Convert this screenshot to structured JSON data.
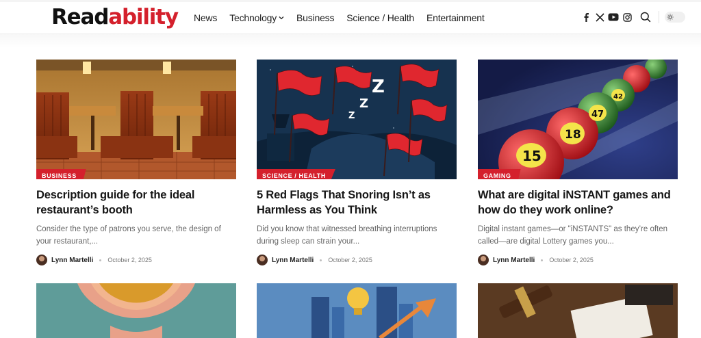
{
  "header": {
    "logo_part1": "Read",
    "logo_part2": "ability",
    "nav": [
      {
        "label": "News"
      },
      {
        "label": "Technology"
      },
      {
        "label": "Business"
      },
      {
        "label": "Science / Health"
      },
      {
        "label": "Entertainment"
      }
    ],
    "icons": [
      "facebook-icon",
      "x-twitter-icon",
      "youtube-icon",
      "instagram-icon",
      "search-icon"
    ],
    "theme_toggle": "sun-icon"
  },
  "posts": [
    {
      "category": "BUSINESS",
      "title": "Description guide for the ideal restaurant’s booth",
      "excerpt": "Consider the type of patrons you serve, the design of your restaurant,...",
      "author": "Lynn Martelli",
      "date": "October 2, 2025"
    },
    {
      "category": "SCIENCE / HEALTH",
      "title": "5 Red Flags That Snoring Isn’t as Harmless as You Think",
      "excerpt": "Did you know that witnessed breathing interruptions during sleep can strain your...",
      "author": "Lynn Martelli",
      "date": "October 2, 2025"
    },
    {
      "category": "GAMING",
      "title": "What are digital iNSTANT games and how do they work online?",
      "excerpt": "Digital instant games—or \"iNSTANTS\" as they’re often called—are digital Lottery games you...",
      "author": "Lynn Martelli",
      "date": "October 2, 2025"
    }
  ],
  "lottery_ball_numbers": [
    "15",
    "18",
    "47",
    "42"
  ],
  "colors": {
    "accent": "#d4202c",
    "text": "#161616",
    "muted": "#666666"
  }
}
